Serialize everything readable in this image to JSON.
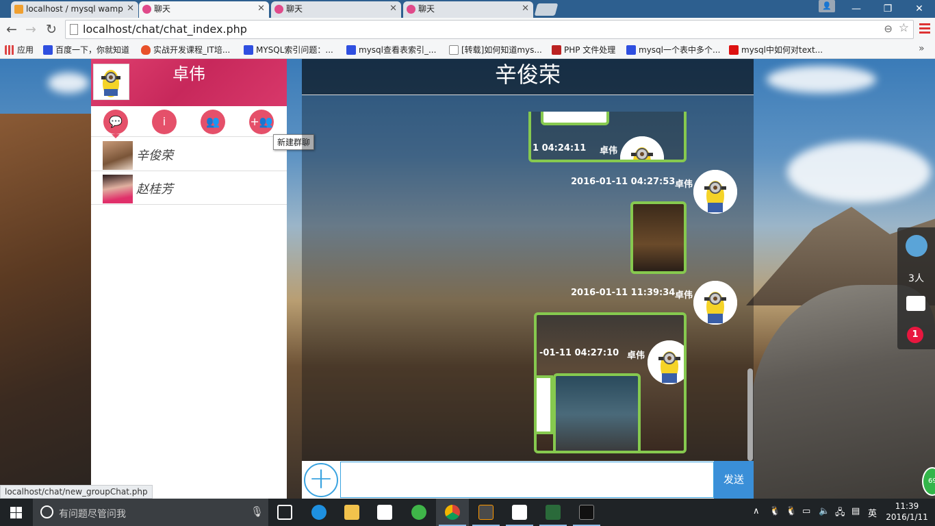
{
  "browser": {
    "tabs": [
      {
        "title": "localhost / mysql wamp",
        "icon": "phpmyadmin-icon"
      },
      {
        "title": "聊天",
        "icon": "chat-favicon"
      },
      {
        "title": "聊天",
        "icon": "chat-favicon"
      },
      {
        "title": "聊天",
        "icon": "chat-favicon"
      }
    ],
    "url": "localhost/chat/chat_index.php",
    "bookmarks": [
      {
        "label": "应用"
      },
      {
        "label": "百度一下，你就知道"
      },
      {
        "label": "实战开发课程_IT培..."
      },
      {
        "label": "MYSQL索引问题：..."
      },
      {
        "label": "mysql查看表索引_..."
      },
      {
        "label": "[转载]如何知道mys..."
      },
      {
        "label": "PHP 文件处理"
      },
      {
        "label": "mysql一个表中多个..."
      },
      {
        "label": "mysql中如何对text..."
      }
    ],
    "status_url": "localhost/chat/new_groupChat.php"
  },
  "sidebar": {
    "username": "卓伟",
    "tabs": [
      {
        "icon": "chat-bubble-icon"
      },
      {
        "icon": "info-icon"
      },
      {
        "icon": "group-icon"
      },
      {
        "icon": "add-group-icon"
      }
    ],
    "tooltip": "新建群聊",
    "contacts": [
      {
        "name": "辛俊荣"
      },
      {
        "name": "赵桂芳"
      }
    ]
  },
  "chat": {
    "title": "辛俊荣",
    "messages": [
      {
        "time": "1 04:24:11",
        "sender": "卓伟"
      },
      {
        "time": "2016-01-11 04:27:53",
        "sender": "卓伟"
      },
      {
        "time": "2016-01-11 11:39:34",
        "sender": "卓伟"
      },
      {
        "time": "-01-11 04:27:10",
        "sender": "卓伟"
      }
    ],
    "input_value": "",
    "send_label": "发送"
  },
  "widget": {
    "online_count": "3人",
    "badge": "1"
  },
  "floating_ball": "69",
  "taskbar": {
    "search_placeholder": "有问题尽管问我",
    "ime": "英",
    "time": "11:39",
    "date": "2016/1/11"
  },
  "colors": {
    "accent_pink": "#e0406f",
    "bubble_green": "#86c94f",
    "send_blue": "#3a8fd8",
    "badge_red": "#e8173f"
  }
}
